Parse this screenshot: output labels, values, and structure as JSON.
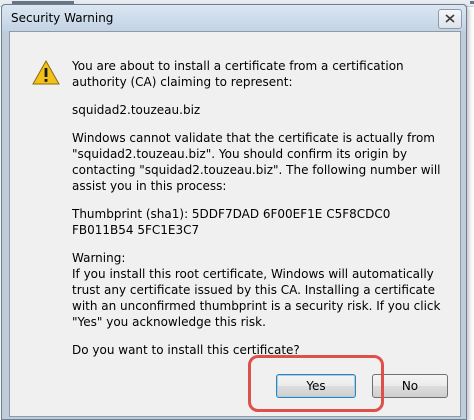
{
  "dialog": {
    "title": "Security Warning",
    "paragraphs": [
      "You are about to install a certificate from a certification authority (CA) claiming to represent:",
      "squidad2.touzeau.biz",
      "Windows cannot validate that the certificate is actually from \"squidad2.touzeau.biz\". You should confirm its origin by contacting \"squidad2.touzeau.biz\". The following number will assist you in this process:",
      "Thumbprint (sha1): 5DDF7DAD 6F00EF1E C5F8CDC0 FB011B54 5FC1E3C7",
      "Warning:\nIf you install this root certificate, Windows will automatically trust any certificate issued by this CA. Installing a certificate with an unconfirmed thumbprint is a security risk. If you click \"Yes\" you acknowledge this risk.",
      "Do you want to install this certificate?"
    ],
    "buttons": {
      "yes": "Yes",
      "no": "No"
    },
    "icons": {
      "warning": "warning-icon",
      "close": "close-icon"
    }
  },
  "colors": {
    "highlight": "#e0504a",
    "warning_fill": "#f2c21b"
  }
}
